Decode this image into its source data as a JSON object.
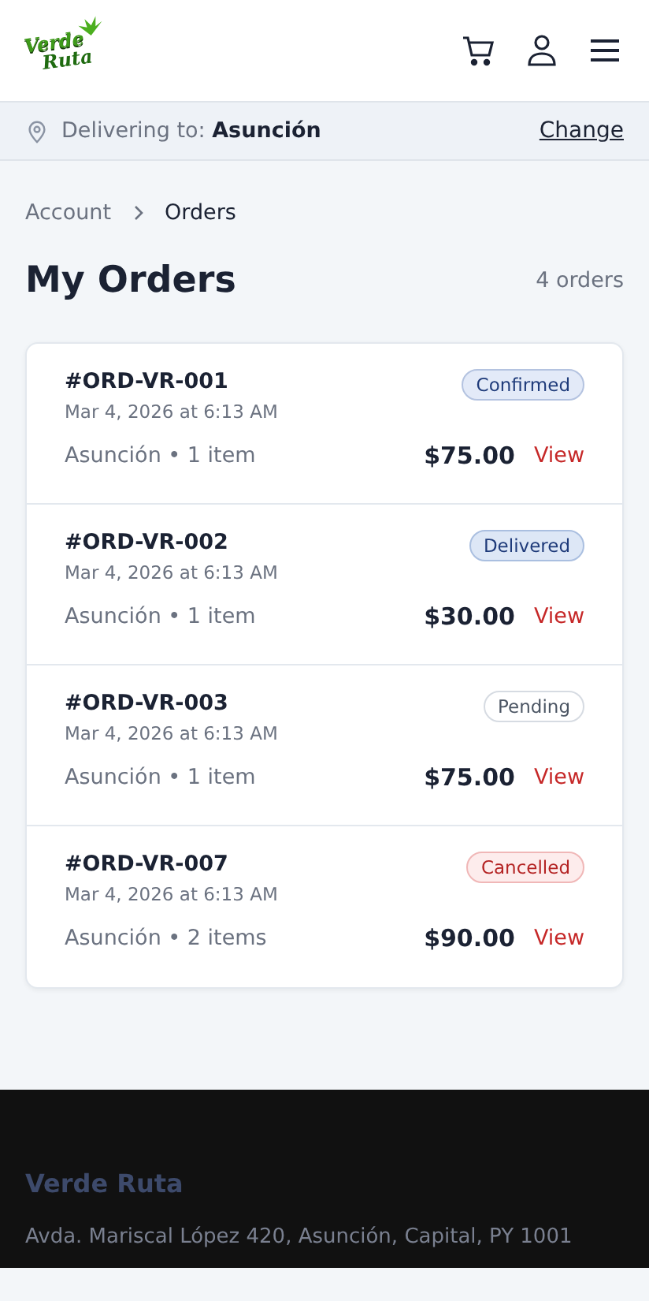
{
  "header": {
    "logo": {
      "line_1": "Verde",
      "line_2": "Ruta"
    }
  },
  "delivery_bar": {
    "label": "Delivering to:",
    "city": "Asunción",
    "action": "Change"
  },
  "breadcrumb": [
    {
      "label": "Account",
      "current": false
    },
    {
      "label": "Orders",
      "current": true
    }
  ],
  "page": {
    "title": "My Orders",
    "count": "4 orders"
  },
  "orders": [
    {
      "id": "#ORD-VR-001",
      "date": "Mar 4, 2026 at 6:13 AM",
      "status": "Confirmed",
      "kind": "confirmed",
      "summary": "Asunción • 1 item",
      "total": "$75.00",
      "action": "View"
    },
    {
      "id": "#ORD-VR-002",
      "date": "Mar 4, 2026 at 6:13 AM",
      "status": "Delivered",
      "kind": "delivered",
      "summary": "Asunción • 1 item",
      "total": "$30.00",
      "action": "View"
    },
    {
      "id": "#ORD-VR-003",
      "date": "Mar 4, 2026 at 6:13 AM",
      "status": "Pending",
      "kind": "pending",
      "summary": "Asunción • 1 item",
      "total": "$75.00",
      "action": "View"
    },
    {
      "id": "#ORD-VR-007",
      "date": "Mar 4, 2026 at 6:13 AM",
      "status": "Cancelled",
      "kind": "cancelled",
      "summary": "Asunción • 2 items",
      "total": "$90.00",
      "action": "View"
    }
  ],
  "footer": {
    "brand": "Verde Ruta",
    "address": "Avda. Mariscal López 420, Asunción, Capital, PY 1001"
  }
}
